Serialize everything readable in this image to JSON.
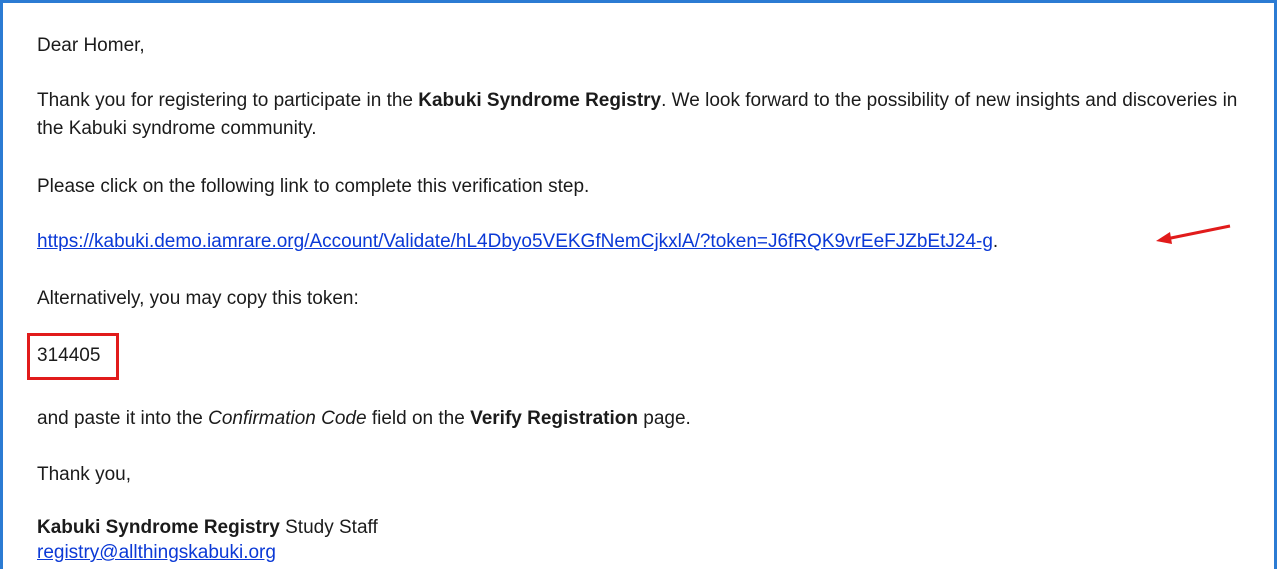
{
  "email": {
    "greeting": "Dear Homer,",
    "para1": {
      "before": "Thank you for registering to participate in the ",
      "bold": "Kabuki Syndrome Registry",
      "after": ". We look forward to the possibility of new insights and discoveries in the Kabuki syndrome community."
    },
    "para2": "Please click on the following link to complete this verification step.",
    "verify_link": "https://kabuki.demo.iamrare.org/Account/Validate/hL4Dbyo5VEKGfNemCjkxlA/?token=J6fRQK9vrEeFJZbEtJ24-g",
    "verify_link_suffix": ".",
    "para3": "Alternatively, you may copy this token:",
    "token": "314405",
    "para4": {
      "before": "and paste it into the ",
      "italic": "Confirmation Code",
      "middle": " field on the ",
      "bold": "Verify Registration",
      "after": " page."
    },
    "closing": "Thank you,",
    "signature": {
      "bold": "Kabuki Syndrome Registry",
      "rest": " Study Staff",
      "email": "registry@allthingskabuki.org"
    }
  },
  "annotations": {
    "arrow_color": "#e11b1b",
    "box_color": "#e11b1b"
  },
  "colors": {
    "frame_border": "#2b7bd3",
    "link": "#0b39d6"
  }
}
